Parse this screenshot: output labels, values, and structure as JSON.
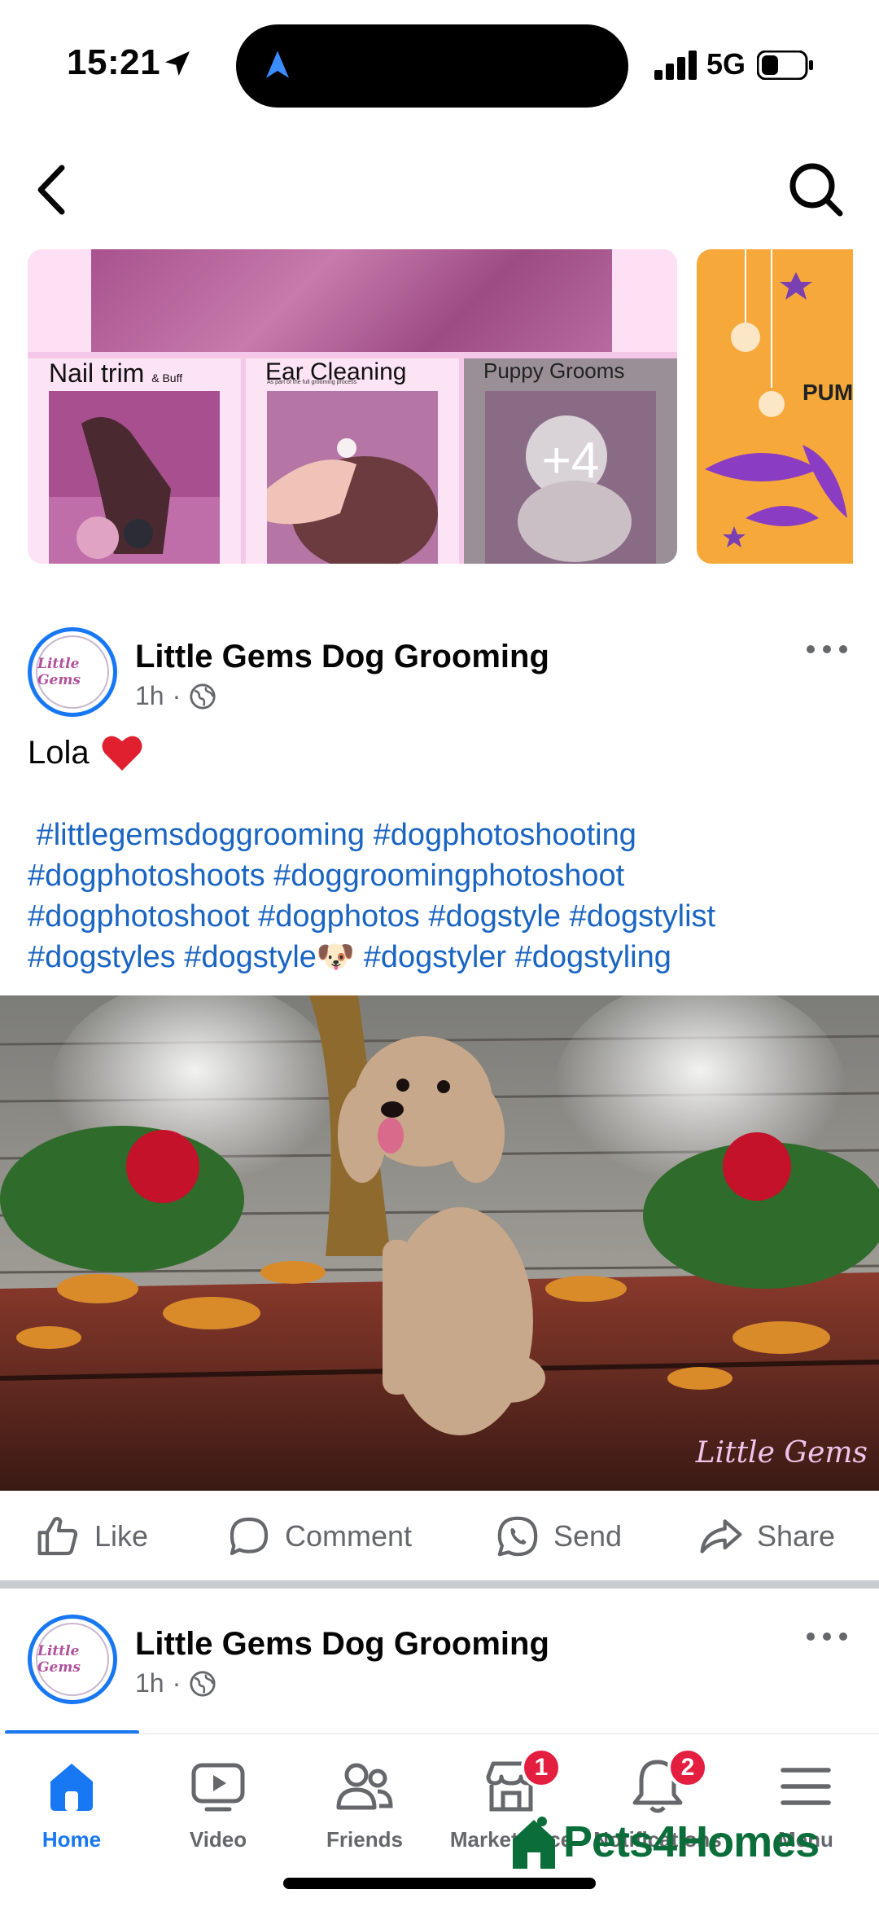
{
  "status_bar": {
    "time": "15:21",
    "network": "5G"
  },
  "nav": {
    "back_icon": "chevron-left-icon",
    "search_icon": "search-icon"
  },
  "album": {
    "tiles": [
      {
        "title": "Nail trim",
        "subtitle": "& Buff"
      },
      {
        "title": "Ear Cleaning",
        "subtitle": "As part of the full grooming process"
      },
      {
        "title": "Puppy Grooms",
        "subtitle": ""
      }
    ],
    "more_count": "+4",
    "next_album_text": "PUM"
  },
  "posts": [
    {
      "author": "Little Gems Dog Grooming",
      "avatar_text": "Little Gems",
      "time": "1h",
      "separator": "·",
      "caption": "Lola",
      "caption_emoji": "❤️",
      "hashtag_lines": [
        " #littlegemsdoggrooming #dogphotoshooting",
        "#dogphotoshoots #doggroomingphotoshoot",
        "#dogphotoshoot #dogphotos #dogstyle #dogstylist",
        "#dogstyles #dogstyle🐶 #dogstyler #dogstyling"
      ],
      "photo_watermark": "Little Gems"
    },
    {
      "author": "Little Gems Dog Grooming",
      "avatar_text": "Little Gems",
      "time": "1h",
      "separator": "·"
    }
  ],
  "actions": {
    "like": "Like",
    "comment": "Comment",
    "send": "Send",
    "share": "Share"
  },
  "tabs": [
    {
      "label": "Home",
      "icon": "home-icon",
      "active": true
    },
    {
      "label": "Video",
      "icon": "video-icon"
    },
    {
      "label": "Friends",
      "icon": "friends-icon"
    },
    {
      "label": "Marketplace",
      "icon": "marketplace-icon",
      "badge": "1"
    },
    {
      "label": "Notifications",
      "icon": "bell-icon",
      "badge": "2"
    },
    {
      "label": "Menu",
      "icon": "menu-icon"
    }
  ],
  "watermark": {
    "brand": "Pets4Homes"
  },
  "colors": {
    "accent": "#1877f2",
    "hashtag": "#1a64c2",
    "badge": "#e41e3f",
    "muted": "#65676b"
  }
}
